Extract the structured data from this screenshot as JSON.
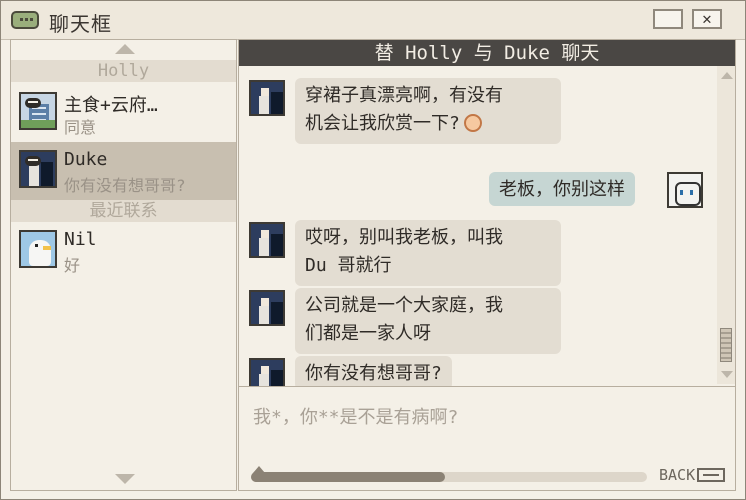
{
  "window": {
    "title": "聊天框",
    "close_glyph": "✕"
  },
  "sidebar": {
    "sections": [
      {
        "header": "Holly",
        "contacts": [
          {
            "name": "主食+云府…",
            "last_message": "同意",
            "avatar": "building-avatar"
          },
          {
            "name": "Duke",
            "last_message": "你有没有想哥哥?",
            "avatar": "duke-avatar",
            "selected": true
          }
        ]
      },
      {
        "header": "最近联系",
        "contacts": [
          {
            "name": "Nil",
            "last_message": "好",
            "avatar": "bird-avatar"
          }
        ]
      }
    ]
  },
  "chat": {
    "header": "替 Holly 与 Duke 聊天",
    "messages": [
      {
        "from": "Duke",
        "text": "穿裙子真漂亮啊，有没有机会让我欣赏一下?"
      },
      {
        "from": "me",
        "text": "老板，你别这样"
      },
      {
        "from": "Duke",
        "text": "哎呀，别叫我老板，叫我Du 哥就行"
      },
      {
        "from": "Duke",
        "text": "公司就是一个大家庭，我们都是一家人呀"
      },
      {
        "from": "Duke",
        "text": "你有没有想哥哥?"
      }
    ],
    "message_lines": {
      "m1_line1": "穿裙子真漂亮啊，有没有",
      "m1_line2": "机会让我欣赏一下?",
      "m3_line1": "哎呀，别叫我老板，叫我",
      "m3_line2": "Du 哥就行",
      "m4_line1": "公司就是一个大家庭，我",
      "m4_line2": "们都是一家人呀"
    },
    "input_text": "我*，你**是不是有病啊?",
    "progress": 0.49,
    "back_label": "BACK"
  },
  "icons": [
    "app-chat-icon",
    "minimize-icon",
    "close-icon",
    "scroll-up-icon",
    "scroll-down-icon",
    "back-arrow-icon",
    "smile-emoji-icon"
  ]
}
